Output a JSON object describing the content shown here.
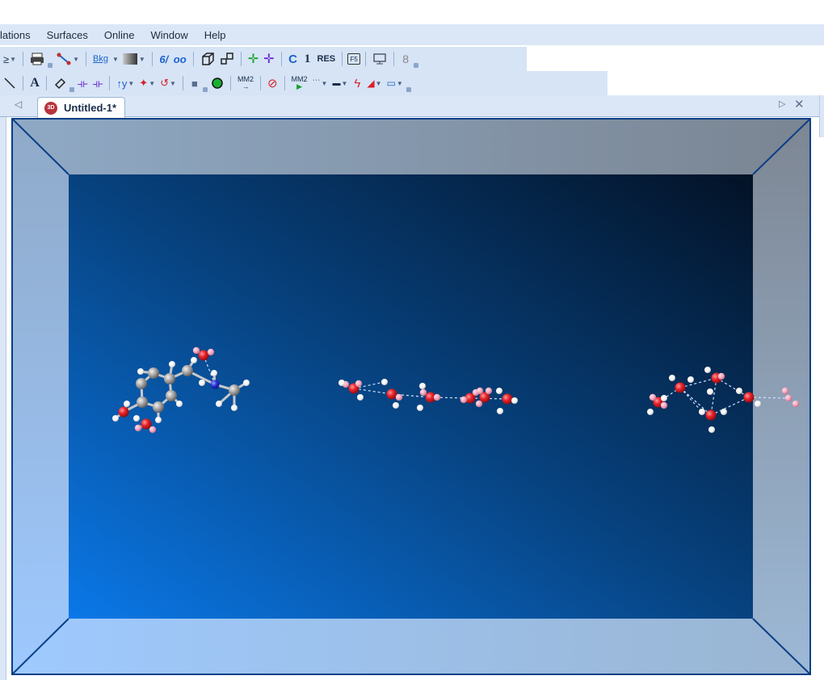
{
  "menubar": {
    "items": [
      "lations",
      "Surfaces",
      "Online",
      "Window",
      "Help"
    ]
  },
  "toolbar1": {
    "bkg_label": "Bkg",
    "c_label": "C",
    "one_label": "1",
    "res_label": "RES",
    "f5_label": "F5"
  },
  "toolbar2": {
    "a_label": "A",
    "mm2_label": "MM2",
    "mm2_run_label": "MM2"
  },
  "tab": {
    "title": "Untitled-1*",
    "icon_text": "3D"
  },
  "colors": {
    "oxygen": "#e8232a",
    "hydrogen": "#ffffff",
    "hydrogen_pink": "#f2a0b8",
    "carbon": "#9a9a9a",
    "nitrogen": "#2a33d6",
    "hbond": "#cfe2ff",
    "background_light": "#0a78e8",
    "background_dark": "#031226",
    "frame_light": "#9ec9ff",
    "frame_dark": "#7a8796"
  }
}
